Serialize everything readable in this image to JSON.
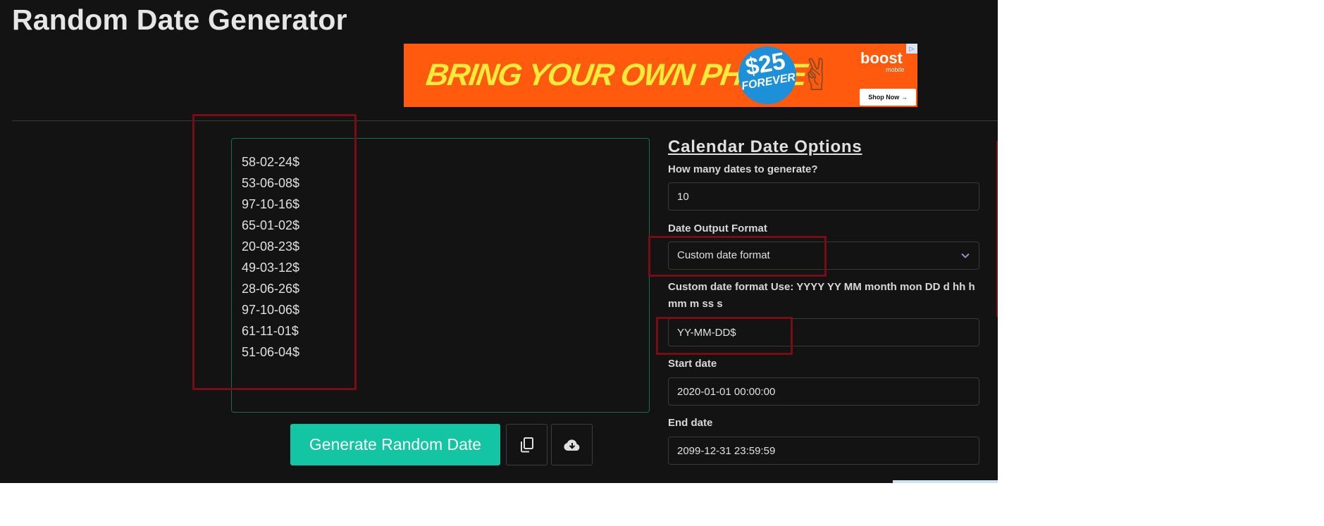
{
  "app": {
    "title": "Random Date Generator"
  },
  "ad": {
    "headline": "BRING YOUR OWN PHONE",
    "price": "$25",
    "price_suffix": "FOREVER",
    "brand": "boost",
    "brand_sub": "mobile",
    "cta": "Shop Now →",
    "adchoice": "▷"
  },
  "output": {
    "lines": [
      "58-02-24$",
      "53-06-08$",
      "97-10-16$",
      "65-01-02$",
      "20-08-23$",
      "49-03-12$",
      "28-06-26$",
      "97-10-06$",
      "61-11-01$",
      "51-06-04$"
    ]
  },
  "actions": {
    "generate_label": "Generate Random Date",
    "copy_icon": "copy-icon",
    "download_icon": "cloud-download-icon"
  },
  "options": {
    "title": "Calendar Date Options",
    "count_label": "How many dates to generate?",
    "count_value": "10",
    "format_label": "Date Output Format",
    "format_value": "Custom date format",
    "custom_label": "Custom date format Use: YYYY YY MM month mon DD d hh h mm m ss s",
    "custom_value": "YY-MM-DD$",
    "start_label": "Start date",
    "start_value": "2020-01-01 00:00:00",
    "end_label": "End date",
    "end_value": "2099-12-31 23:59:59"
  },
  "colors": {
    "background": "#131313",
    "accent": "#14c5a4",
    "annotation": "#7a0c16",
    "ad_orange": "#ff5a0e"
  }
}
